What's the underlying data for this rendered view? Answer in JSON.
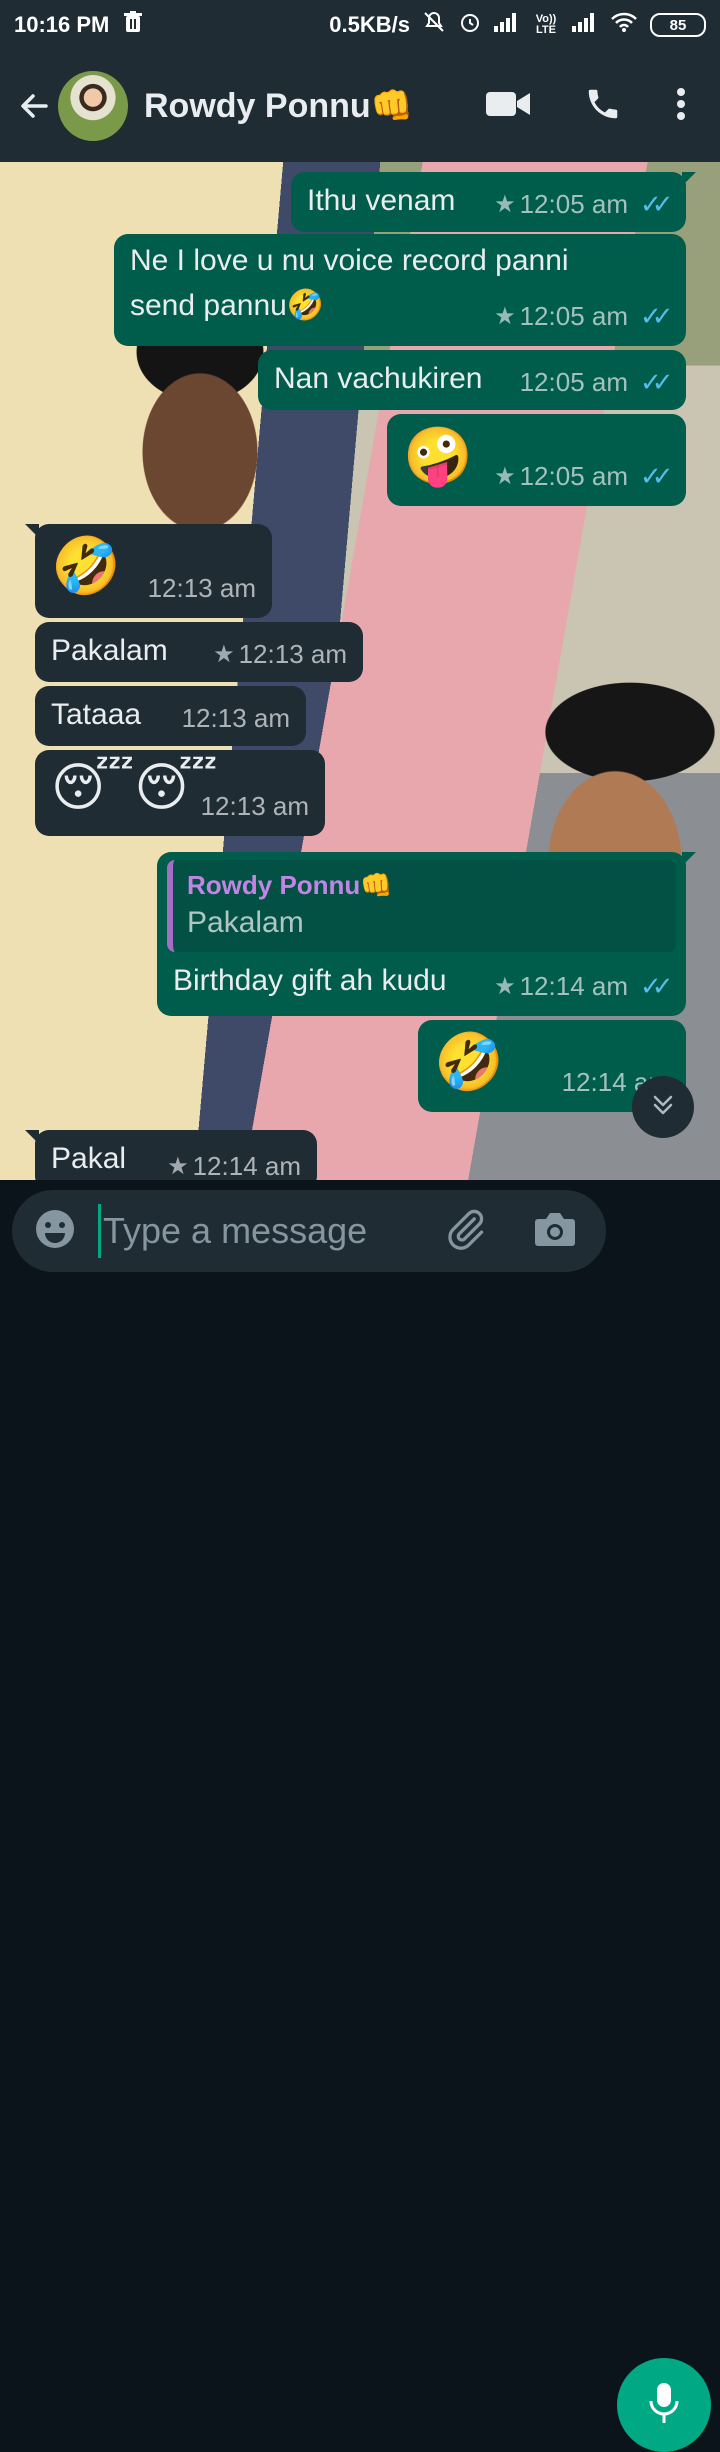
{
  "status_bar": {
    "time": "10:16 PM",
    "speed": "0.5KB/s",
    "volte_label": "Vo)) LTE",
    "battery": "85"
  },
  "header": {
    "contact_name": "Rowdy Ponnu👊"
  },
  "messages": [
    {
      "dir": "out",
      "text": "Ithu venam",
      "time": "12:05 am",
      "starred": true,
      "read": true
    },
    {
      "dir": "out",
      "text": "Ne I love u nu voice record panni send pannu🤣",
      "time": "12:05 am",
      "starred": true,
      "read": true
    },
    {
      "dir": "out",
      "text": "Nan vachukiren",
      "time": "12:05 am",
      "starred": false,
      "read": true
    },
    {
      "dir": "out",
      "text": "🤪",
      "time": "12:05 am",
      "starred": true,
      "read": true
    },
    {
      "dir": "in",
      "text": "🤣",
      "time": "12:13 am",
      "starred": false
    },
    {
      "dir": "in",
      "text": "Pakalam",
      "time": "12:13 am",
      "starred": true
    },
    {
      "dir": "in",
      "text": "Tataaa",
      "time": "12:13 am",
      "starred": false
    },
    {
      "dir": "in",
      "text": "😴😴",
      "time": "12:13 am",
      "starred": false
    },
    {
      "dir": "out",
      "quote_name": "Rowdy Ponnu👊",
      "quote_text": "Pakalam",
      "text": "Birthday gift ah kudu",
      "time": "12:14 am",
      "starred": true,
      "read": true
    },
    {
      "dir": "out",
      "text": "🤣",
      "time": "12:14 am",
      "starred": false,
      "read": false
    },
    {
      "dir": "in",
      "text": "Pakal",
      "time": "12:14 am",
      "starred": true
    }
  ],
  "composer": {
    "placeholder": "Type a message"
  },
  "icons": [
    "back-arrow-icon",
    "video-call-icon",
    "phone-icon",
    "more-vert-icon",
    "emoji-icon",
    "attach-icon",
    "camera-icon",
    "mic-icon",
    "scroll-down-icon",
    "star-icon",
    "double-check-icon",
    "trash-icon",
    "mute-icon",
    "alarm-icon",
    "signal-icon",
    "wifi-icon"
  ],
  "colors": {
    "header_bg": "#1f2c34",
    "outgoing_bubble": "#005c4b",
    "incoming_bubble": "#1f2c34",
    "read_ticks": "#53bdeb",
    "accent": "#00a884",
    "quote_name": "#c285e3"
  }
}
